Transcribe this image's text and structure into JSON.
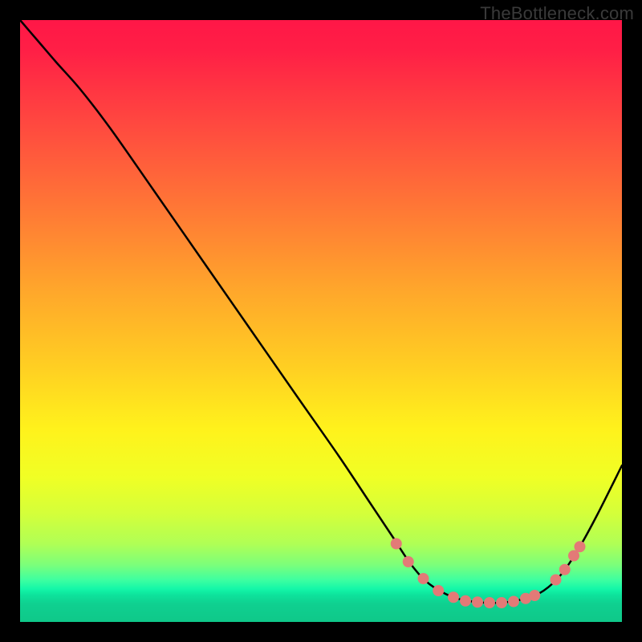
{
  "watermark": "TheBottleneck.com",
  "colors": {
    "gradient": [
      {
        "stop": 0.0,
        "hex": "#ff1747"
      },
      {
        "stop": 0.05,
        "hex": "#ff1f46"
      },
      {
        "stop": 0.18,
        "hex": "#ff4b3f"
      },
      {
        "stop": 0.32,
        "hex": "#ff7a35"
      },
      {
        "stop": 0.45,
        "hex": "#ffa72b"
      },
      {
        "stop": 0.58,
        "hex": "#ffd022"
      },
      {
        "stop": 0.68,
        "hex": "#fff21c"
      },
      {
        "stop": 0.76,
        "hex": "#f0ff25"
      },
      {
        "stop": 0.82,
        "hex": "#d4ff3a"
      },
      {
        "stop": 0.87,
        "hex": "#b0ff55"
      },
      {
        "stop": 0.905,
        "hex": "#7cff7a"
      },
      {
        "stop": 0.93,
        "hex": "#3effa0"
      },
      {
        "stop": 0.945,
        "hex": "#14f7a8"
      },
      {
        "stop": 0.955,
        "hex": "#0de39c"
      },
      {
        "stop": 0.97,
        "hex": "#0fd090"
      },
      {
        "stop": 1.0,
        "hex": "#0fc889"
      }
    ],
    "curve_stroke": "#000000",
    "dot_fill": "#e37a77"
  },
  "chart_data": {
    "type": "line",
    "title": "",
    "xlabel": "",
    "ylabel": "",
    "xlim": [
      0,
      100
    ],
    "ylim": [
      0,
      100
    ],
    "series": [
      {
        "name": "curve",
        "points": [
          {
            "x": 0.0,
            "y": 100.0
          },
          {
            "x": 3.0,
            "y": 96.5
          },
          {
            "x": 6.0,
            "y": 93.0
          },
          {
            "x": 10.0,
            "y": 88.5
          },
          {
            "x": 15.0,
            "y": 82.0
          },
          {
            "x": 22.0,
            "y": 72.0
          },
          {
            "x": 30.0,
            "y": 60.5
          },
          {
            "x": 38.0,
            "y": 49.0
          },
          {
            "x": 46.0,
            "y": 37.5
          },
          {
            "x": 53.0,
            "y": 27.5
          },
          {
            "x": 58.0,
            "y": 20.0
          },
          {
            "x": 62.0,
            "y": 14.0
          },
          {
            "x": 65.0,
            "y": 9.5
          },
          {
            "x": 68.0,
            "y": 6.3
          },
          {
            "x": 72.0,
            "y": 4.1
          },
          {
            "x": 76.0,
            "y": 3.3
          },
          {
            "x": 80.0,
            "y": 3.2
          },
          {
            "x": 84.0,
            "y": 3.9
          },
          {
            "x": 87.0,
            "y": 5.2
          },
          {
            "x": 90.0,
            "y": 8.0
          },
          {
            "x": 93.0,
            "y": 12.5
          },
          {
            "x": 96.0,
            "y": 18.0
          },
          {
            "x": 100.0,
            "y": 26.0
          }
        ]
      }
    ],
    "markers": [
      {
        "x": 62.5,
        "y": 13.0
      },
      {
        "x": 64.5,
        "y": 10.0
      },
      {
        "x": 67.0,
        "y": 7.2
      },
      {
        "x": 69.5,
        "y": 5.2
      },
      {
        "x": 72.0,
        "y": 4.1
      },
      {
        "x": 74.0,
        "y": 3.5
      },
      {
        "x": 76.0,
        "y": 3.3
      },
      {
        "x": 78.0,
        "y": 3.2
      },
      {
        "x": 80.0,
        "y": 3.2
      },
      {
        "x": 82.0,
        "y": 3.4
      },
      {
        "x": 84.0,
        "y": 3.9
      },
      {
        "x": 85.5,
        "y": 4.4
      },
      {
        "x": 89.0,
        "y": 7.0
      },
      {
        "x": 90.5,
        "y": 8.7
      },
      {
        "x": 92.0,
        "y": 11.0
      },
      {
        "x": 93.0,
        "y": 12.5
      }
    ]
  }
}
